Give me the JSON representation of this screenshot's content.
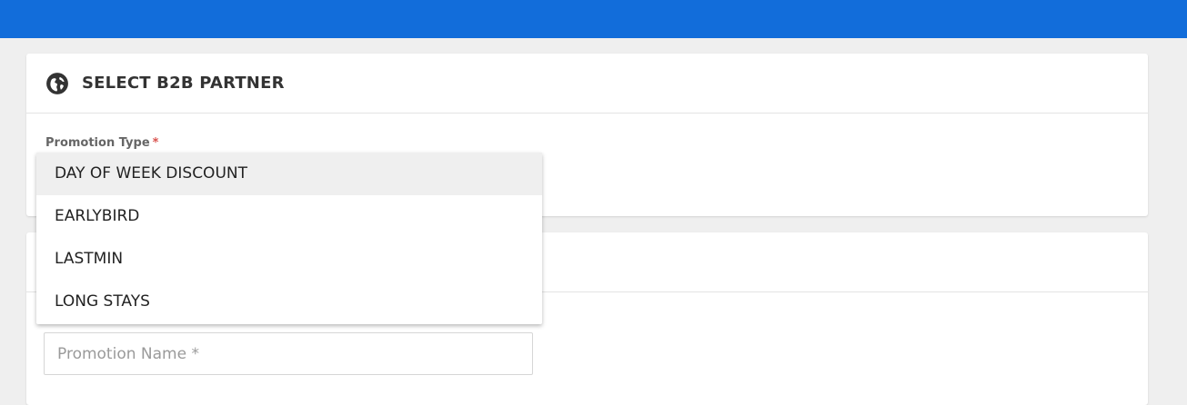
{
  "topbar": {
    "color": "#126dda"
  },
  "partner_card": {
    "icon": "globe-icon",
    "title": "SELECT B2B PARTNER",
    "promotion_type": {
      "label": "Promotion Type",
      "required_marker": "*",
      "options": [
        "DAY OF WEEK DISCOUNT",
        "EARLYBIRD",
        "LASTMIN",
        "LONG STAYS"
      ],
      "highlighted_index": 0
    }
  },
  "details_card": {
    "promotion_name": {
      "value": "",
      "placeholder": "Promotion Name *"
    }
  },
  "colors": {
    "accent": "#126dda",
    "required": "#d9534f",
    "background": "#efefef"
  }
}
